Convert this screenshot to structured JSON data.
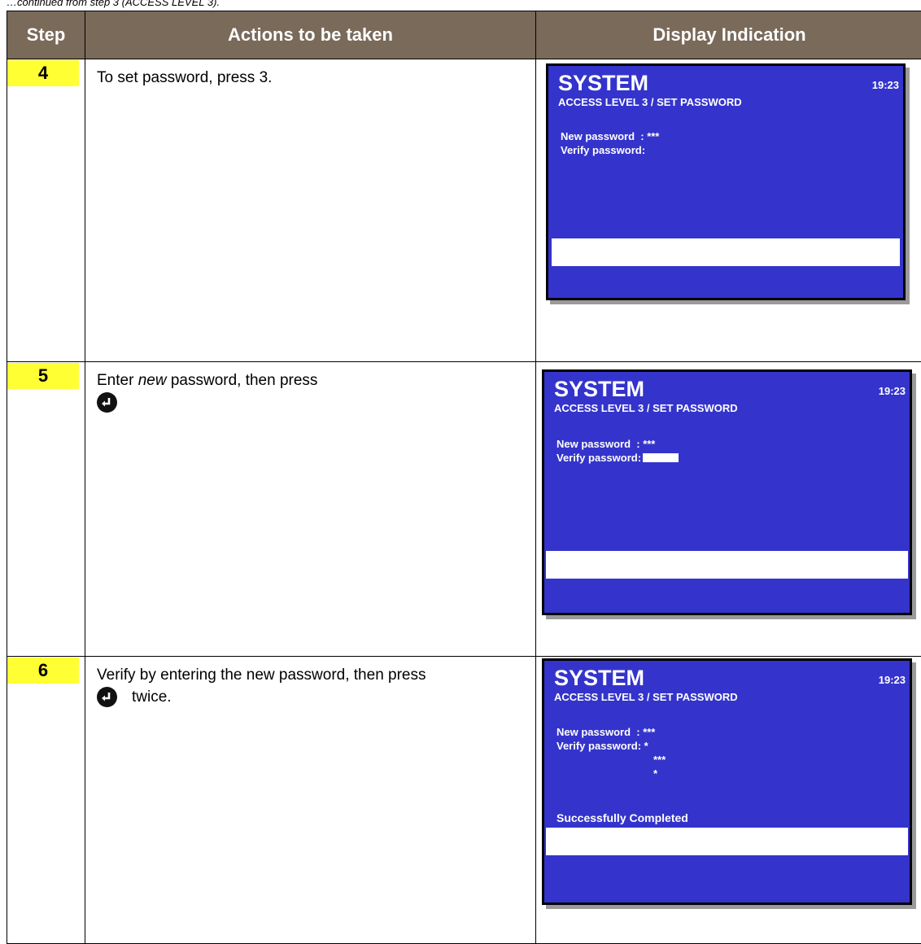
{
  "caption": "…continued from step 3 (ACCESS LEVEL 3).",
  "header": {
    "step": "Step",
    "actions": "Actions to be taken",
    "display": "Display Indication"
  },
  "rows": [
    {
      "step": "4",
      "action_text": "To set password, press 3.",
      "screen": {
        "title": "SYSTEM",
        "clock": "19:23",
        "subtitle": "ACCESS LEVEL 3 / SET PASSWORD",
        "new_password": "New password  : ***",
        "verify_password": "Verify password:"
      }
    },
    {
      "step": "5",
      "action_pre": "Enter ",
      "action_em": "new",
      "action_post": " password, then press",
      "screen": {
        "title": "SYSTEM",
        "clock": "19:23",
        "subtitle": "ACCESS LEVEL 3 / SET PASSWORD",
        "new_password": "New password  : ***",
        "verify_password": "Verify password:"
      }
    },
    {
      "step": "6",
      "action_text": "Verify by entering the new password, then press",
      "action_suffix": "twice.",
      "screen": {
        "title": "SYSTEM",
        "clock": "19:23",
        "subtitle": "ACCESS LEVEL 3 / SET PASSWORD",
        "new_password": "New password  : ***",
        "verify_password": "Verify password: *",
        "verify_line2": "***",
        "verify_line3": "*",
        "message": "Successfully Completed"
      }
    }
  ],
  "icons": {
    "enter_key": "enter-key-icon"
  },
  "colors": {
    "header_bg": "#7a6a5a",
    "step_highlight": "#ffff33",
    "screen_bg": "#3434cc"
  }
}
